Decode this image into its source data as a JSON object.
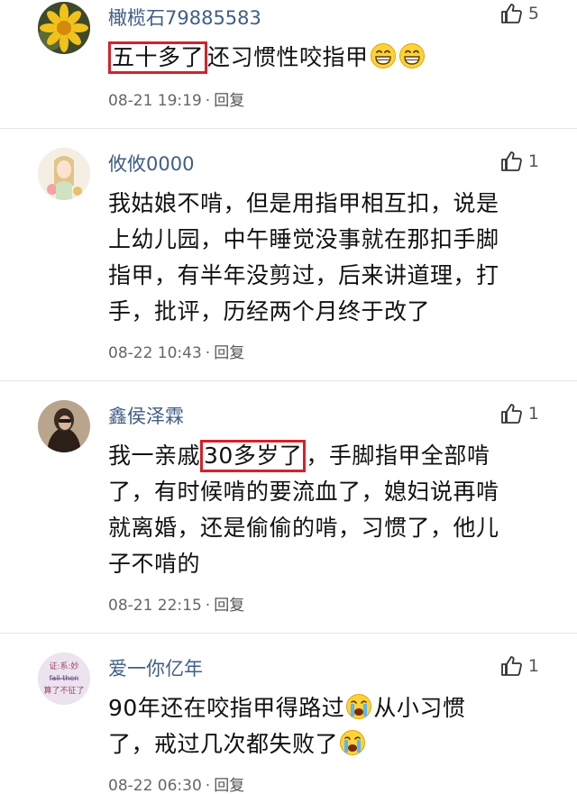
{
  "comments": [
    {
      "username": "橄榄石79885583",
      "likes": "5",
      "text_highlight": "五十多了",
      "text_rest": "还习惯性咬指甲",
      "emoji": "grin-emoji",
      "timestamp": "08-21 19:19",
      "separator": "·",
      "reply": "回复"
    },
    {
      "username": "攸攸0000",
      "likes": "1",
      "lines": [
        "我姑娘不啃，但是用指甲相互扣，说是",
        "上幼儿园，中午睡觉没事就在那扣手脚",
        "指甲，有半年没剪过，后来讲道理，打",
        "手，批评，历经两个月终于改了"
      ],
      "timestamp": "08-22 10:43",
      "separator": "·",
      "reply": "回复"
    },
    {
      "username": "鑫侯泽霖",
      "likes": "1",
      "text_pre": "我一亲戚",
      "text_highlight": "30多岁了",
      "text_post": "，手脚指甲全部啃",
      "lines": [
        "了，有时候啃的要流血了，媳妇说再啃",
        "就离婚，还是偷偷的啃，习惯了，他儿",
        "子不啃的"
      ],
      "timestamp": "08-21 22:15",
      "separator": "·",
      "reply": "回复"
    },
    {
      "username": "爱一你亿年",
      "likes": "1",
      "text_a": "90年还在咬指甲得路过",
      "text_b": "从小习惯",
      "text_c": "了，戒过几次都失败了",
      "emoji": "crying-emoji",
      "avatar_text": [
        "证:系:妙",
        "fall then",
        "算了不征了"
      ],
      "timestamp": "08-22 06:30",
      "separator": "·",
      "reply": "回复"
    }
  ],
  "colors": {
    "username": "#405e86",
    "highlight_border": "#d8202a",
    "meta": "#666666"
  }
}
